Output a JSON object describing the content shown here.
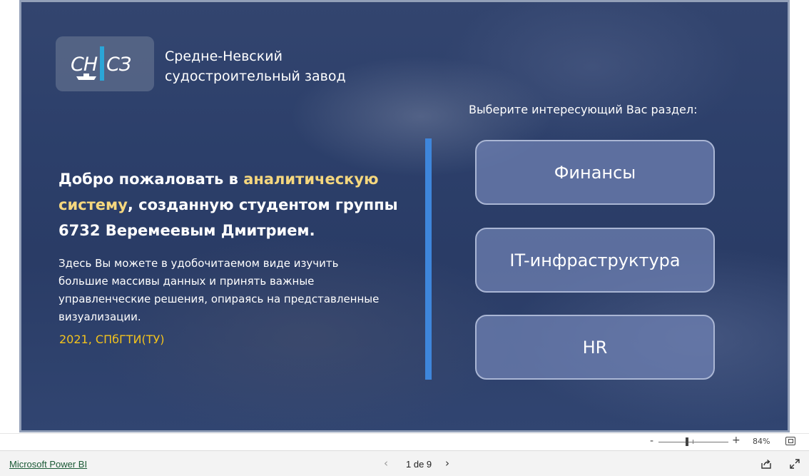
{
  "logo": {
    "text": "СНСЗ",
    "icon": "ship-logo-icon"
  },
  "company": {
    "name_line1": "Средне-Невский",
    "name_line2": "судостроительный завод"
  },
  "welcome": {
    "part1": "Добро пожаловать в ",
    "highlight": "аналитическую систему",
    "part2": ", созданную студентом группы 6732 Веремеевым Дмитрием."
  },
  "description": "Здесь Вы можете в удобочитаемом виде изучить большие массивы данных и принять важные управленческие решения, опираясь на представленные визуализации.",
  "year_label": "2021, СПбГТИ(ТУ)",
  "nav": {
    "prompt": "Выберите интересующий Вас раздел:",
    "buttons": [
      {
        "label": "Финансы"
      },
      {
        "label": "IT-инфраструктура"
      },
      {
        "label": "HR"
      }
    ]
  },
  "zoom": {
    "minus": "-",
    "plus": "+",
    "value": "84%",
    "level": 0.84
  },
  "footer": {
    "link": "Microsoft Power BI",
    "prev": "‹",
    "page_text": "1 de 9",
    "next": "›"
  },
  "colors": {
    "highlight": "#f5d77e",
    "year": "#f2c21d",
    "divider": "#3e86db",
    "logo_accent": "#2aa6d8"
  }
}
